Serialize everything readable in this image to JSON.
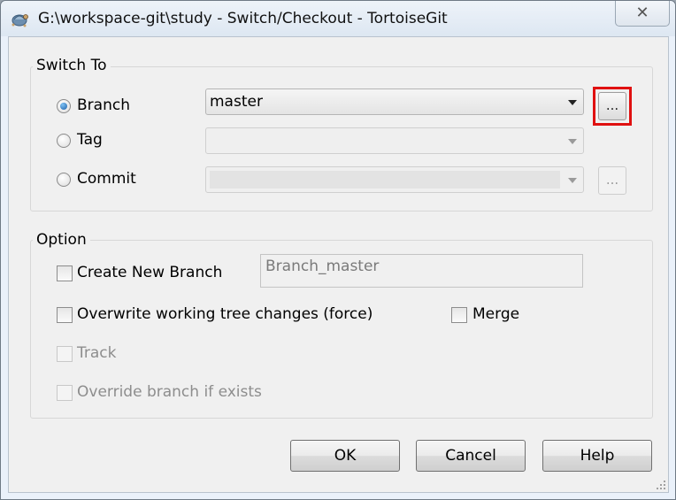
{
  "window": {
    "title": "G:\\workspace-git\\study - Switch/Checkout - TortoiseGit",
    "close_label": "✕"
  },
  "switch_to": {
    "group_label": "Switch To",
    "branch": {
      "label": "Branch",
      "selected": true,
      "value": "master",
      "browse_label": "..."
    },
    "tag": {
      "label": "Tag",
      "selected": false,
      "value": ""
    },
    "commit": {
      "label": "Commit",
      "selected": false,
      "value": "",
      "browse_label": "..."
    }
  },
  "option": {
    "group_label": "Option",
    "create_new_branch": {
      "label": "Create New Branch",
      "checked": false,
      "value": "Branch_master"
    },
    "overwrite": {
      "label": "Overwrite working tree changes (force)",
      "checked": false
    },
    "merge": {
      "label": "Merge",
      "checked": false
    },
    "track": {
      "label": "Track",
      "checked": false,
      "enabled": false
    },
    "override_branch": {
      "label": "Override branch if exists",
      "checked": false,
      "enabled": false
    }
  },
  "buttons": {
    "ok": "OK",
    "cancel": "Cancel",
    "help": "Help"
  },
  "colors": {
    "highlight": "#e01010",
    "radio_selected": "#1d5fa8"
  }
}
